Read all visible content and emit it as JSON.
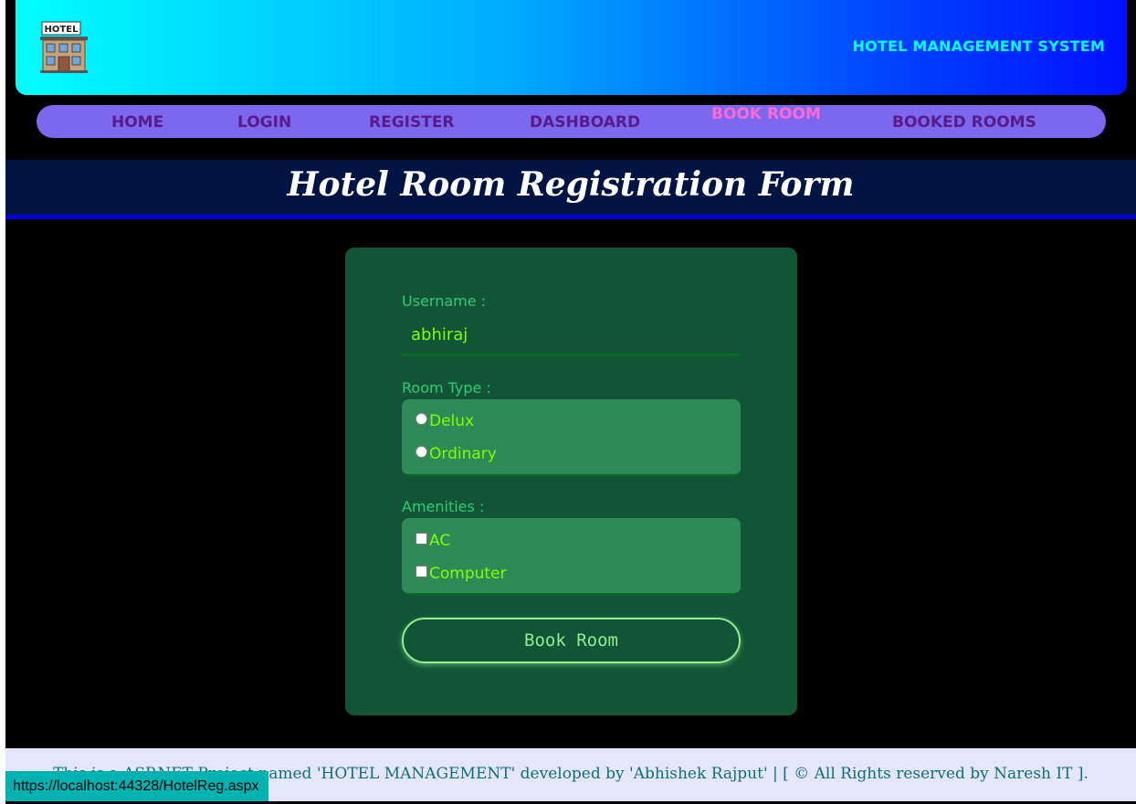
{
  "header": {
    "logo_text": "HOTEL",
    "title": "HOTEL MANAGEMENT SYSTEM"
  },
  "nav": {
    "items": [
      {
        "label": "HOME"
      },
      {
        "label": "LOGIN"
      },
      {
        "label": "REGISTER"
      },
      {
        "label": "DASHBOARD"
      },
      {
        "label": "BOOK ROOM",
        "active": true
      },
      {
        "label": "BOOKED ROOMS"
      }
    ]
  },
  "page_title": "Hotel Room Registration Form",
  "form": {
    "username_label": "Username :",
    "username_value": "abhiraj",
    "room_type_label": "Room Type :",
    "room_types": [
      {
        "label": "Delux",
        "checked": false
      },
      {
        "label": "Ordinary",
        "checked": false
      }
    ],
    "amenities_label": "Amenities :",
    "amenities": [
      {
        "label": "AC",
        "checked": false
      },
      {
        "label": "Computer",
        "checked": false
      }
    ],
    "submit_label": "Book Room"
  },
  "footer": {
    "text": "This is a ASP.NET Project named 'HOTEL MANAGEMENT' developed by 'Abhishek Rajput' | [ © All Rights reserved by Naresh IT ]."
  },
  "status_bar": {
    "url": "https://localhost:44328/HotelReg.aspx"
  },
  "colors": {
    "header_gradient_start": "#00ffff",
    "header_gradient_end": "#0010ff",
    "nav_bg": "#7b68ee",
    "nav_text": "#5a1a8a",
    "nav_active": "#ff69d4",
    "title_bar_bg": "#001444",
    "card_bg": "#115536",
    "option_bg": "#2e8b57",
    "option_text": "#7fff00",
    "label_text": "#2ecc71",
    "footer_bg": "#e6e6fa"
  }
}
